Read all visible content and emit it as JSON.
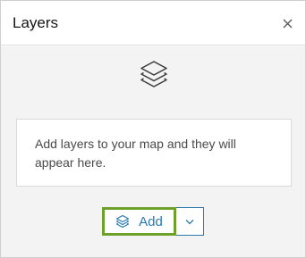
{
  "panel": {
    "title": "Layers",
    "close_icon": "close-icon"
  },
  "empty_state": {
    "icon": "layers-icon",
    "message": "Add layers to your map and they will appear here."
  },
  "add": {
    "label": "Add",
    "icon": "layers-add-icon",
    "dropdown_icon": "chevron-down-icon"
  },
  "colors": {
    "accent": "#2a7ab0",
    "highlight": "#6ea12c",
    "body_background": "#f3f3f3"
  }
}
